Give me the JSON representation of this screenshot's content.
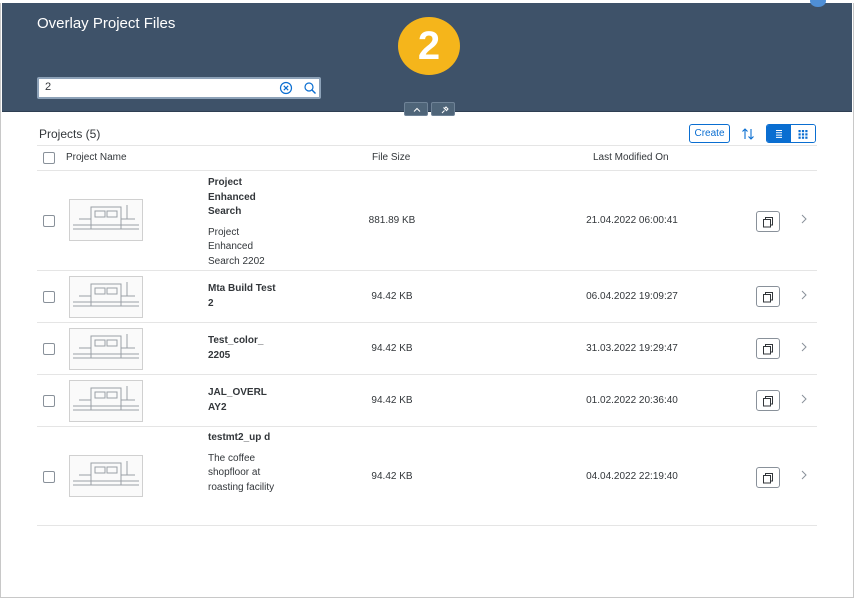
{
  "header": {
    "title": "Overlay Project Files",
    "step_badge": "2",
    "search": {
      "value": "2"
    }
  },
  "toolbar": {
    "title": "Projects (5)",
    "create_label": "Create"
  },
  "table": {
    "columns": {
      "name": "Project Name",
      "size": "File Size",
      "modified": "Last Modified On"
    },
    "rows": [
      {
        "title": "Project Enhanced Search",
        "description": "Project Enhanced Search 2202",
        "size": "881.89 KB",
        "modified": "21.04.2022 06:00:41"
      },
      {
        "title": "Mta Build Test 2",
        "description": "",
        "size": "94.42 KB",
        "modified": "06.04.2022 19:09:27"
      },
      {
        "title": "Test_color_ 2205",
        "description": "",
        "size": "94.42 KB",
        "modified": "31.03.2022 19:29:47"
      },
      {
        "title": "JAL_OVERL AY2",
        "description": "",
        "size": "94.42 KB",
        "modified": "01.02.2022 20:36:40"
      },
      {
        "title": "testmt2_up d",
        "description": "The coffee shopfloor at roasting facility",
        "size": "94.42 KB",
        "modified": "04.04.2022 22:19:40"
      }
    ]
  },
  "icons": {
    "clear": "clear-circle-icon",
    "search": "search-icon",
    "collapse": "chevron-up-icon",
    "pin": "pin-icon",
    "sort": "sort-icon",
    "list_view": "list-view-icon",
    "grid_view": "grid-view-icon",
    "copy": "copy-icon",
    "navigate": "chevron-right-icon",
    "thumbnail": "project-thumbnail"
  },
  "colors": {
    "header_bg": "#3e5269",
    "accent": "#0a6ed1",
    "badge": "#f5b51b"
  }
}
